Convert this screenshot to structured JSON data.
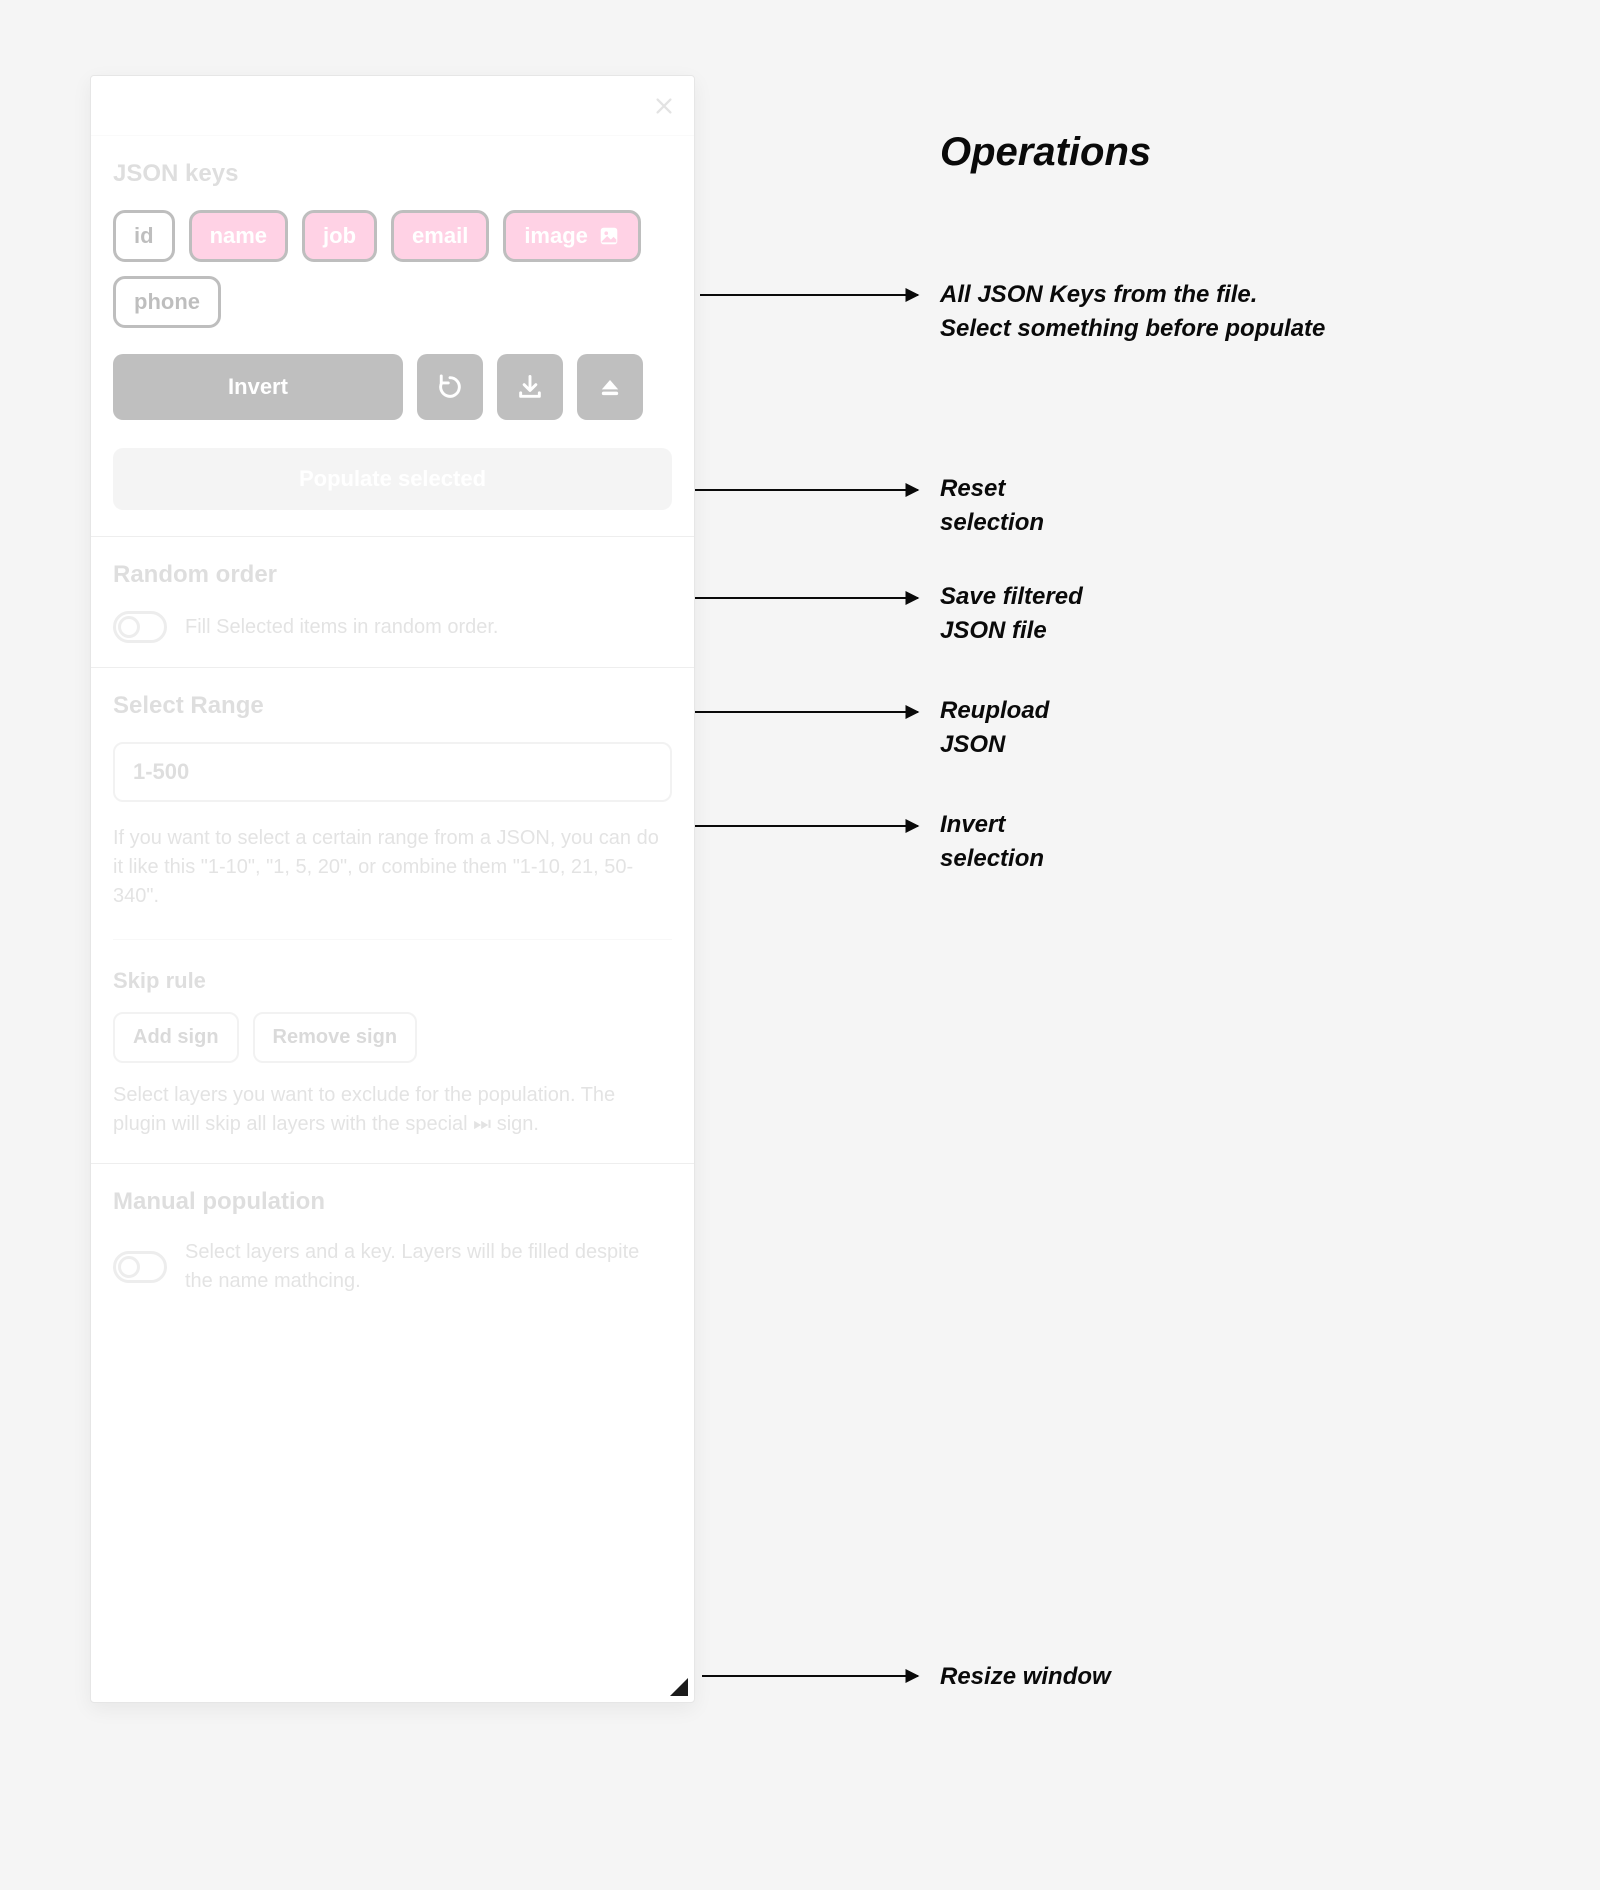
{
  "annotations": {
    "title": "Operations",
    "keys_note": "All JSON Keys from the file.\nSelect something before populate",
    "reset": "Reset\nselection",
    "save": "Save filtered\nJSON file",
    "reupload": "Reupload\nJSON",
    "invert": "Invert\nselection",
    "resize": "Resize window"
  },
  "panel": {
    "json_keys_heading": "JSON keys",
    "keys": {
      "id": "id",
      "name": "name",
      "job": "job",
      "email": "email",
      "image": "image",
      "phone": "phone"
    },
    "invert_label": "Invert",
    "populate_label": "Populate selected",
    "random": {
      "heading": "Random order",
      "desc": "Fill Selected items in random order."
    },
    "range": {
      "heading": "Select Range",
      "placeholder": "1-500",
      "desc": "If you want to select a certain range from a JSON, you can do it like this \"1-10\", \"1, 5, 20\", or combine them \"1-10, 21, 50-340\"."
    },
    "skip": {
      "heading": "Skip rule",
      "add": "Add sign",
      "remove": "Remove sign",
      "desc": "Select layers you want to exclude for the population. The plugin will skip all layers with the special ⏭ sign."
    },
    "manual": {
      "heading": "Manual population",
      "desc": "Select layers and a key. Layers will be filled despite the name mathcing."
    }
  }
}
